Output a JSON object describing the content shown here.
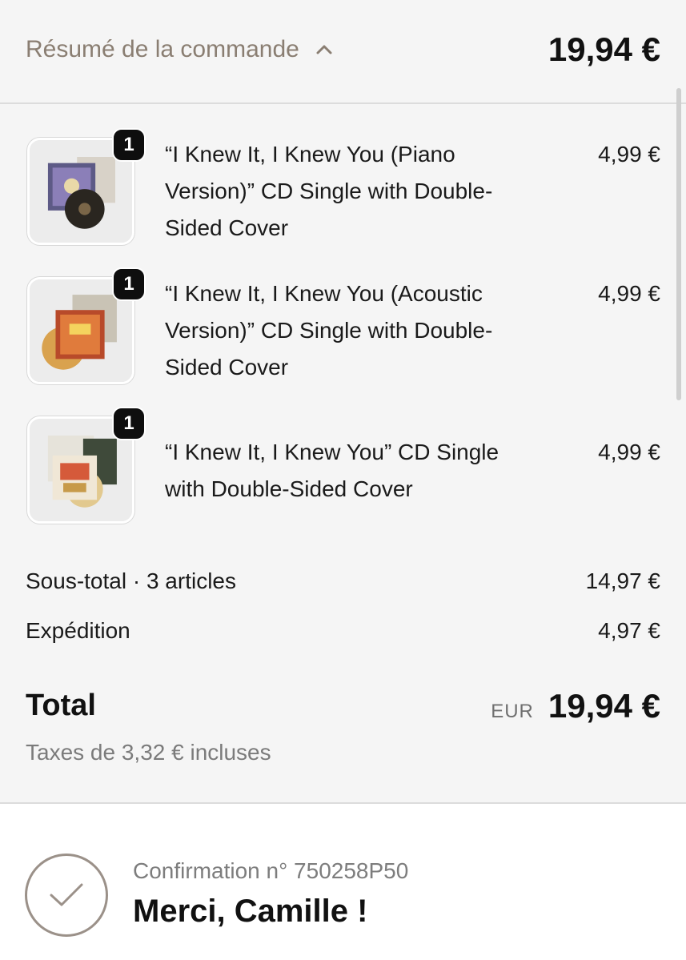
{
  "header": {
    "summary_label": "Résumé de la commande",
    "total": "19,94 €"
  },
  "items": [
    {
      "qty": "1",
      "title": "“I Knew It, I Knew You (Piano Version)” CD Single with Double-Sided Cover",
      "price": "4,99 €",
      "thumb_icon": "cd-single-piano-icon"
    },
    {
      "qty": "1",
      "title": "“I Knew It, I Knew You (Acoustic Version)” CD Single with Double-Sided Cover",
      "price": "4,99 €",
      "thumb_icon": "cd-single-acoustic-icon"
    },
    {
      "qty": "1",
      "title": "“I Knew It, I Knew You” CD Single with Double-Sided Cover",
      "price": "4,99 €",
      "thumb_icon": "cd-single-icon"
    }
  ],
  "totals": {
    "subtotal_label": "Sous-total · 3 articles",
    "subtotal_value": "14,97 €",
    "shipping_label": "Expédition",
    "shipping_value": "4,97 €",
    "total_label": "Total",
    "currency": "EUR",
    "total_value": "19,94 €",
    "tax_note": "Taxes de 3,32 € incluses"
  },
  "confirmation": {
    "number": "Confirmation n° 750258P50",
    "thanks": "Merci, Camille !"
  },
  "colors": {
    "accent": "#8a7e72",
    "background": "#f5f5f5",
    "badge": "#0e0e0e"
  }
}
